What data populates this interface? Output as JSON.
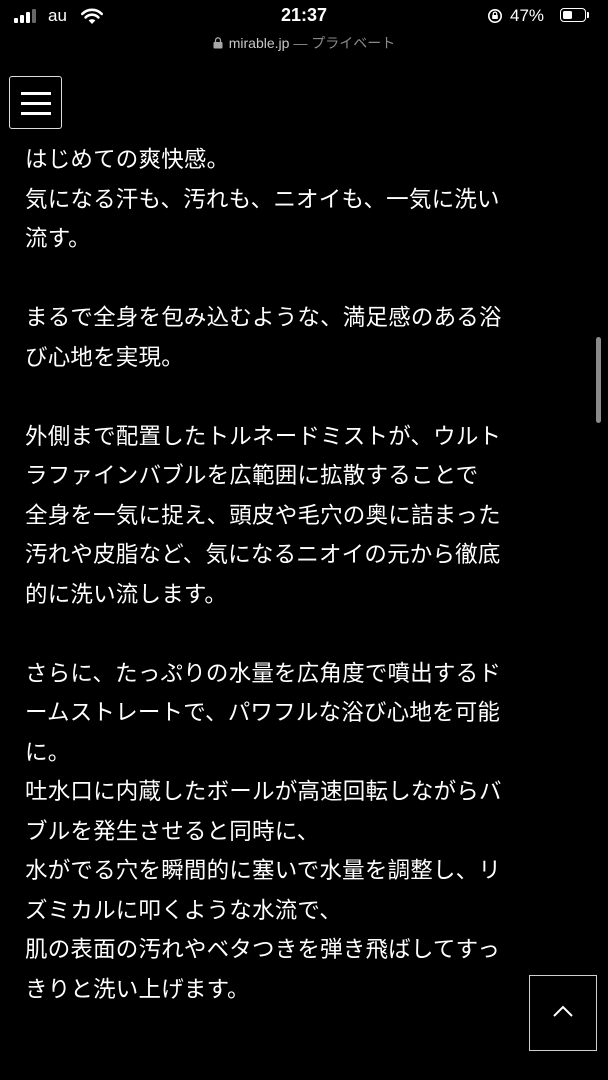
{
  "status_bar": {
    "carrier": "au",
    "time": "21:37",
    "battery_percent": "47%",
    "battery_level": 0.47,
    "icons": [
      "signal-icon",
      "wifi-icon",
      "rotation-lock-icon",
      "battery-icon"
    ]
  },
  "browser": {
    "domain": "mirable.jp",
    "private_label": "— プライベート",
    "lock_icon": "lock-icon"
  },
  "menu": {
    "icon": "hamburger-menu-icon"
  },
  "article": {
    "paragraphs": [
      "はじめての爽快感。\n気になる汗も、汚れも、ニオイも、一気に洗い\n流す。",
      "まるで全身を包み込むような、満足感のある浴\nび心地を実現。",
      "外側まで配置したトルネードミストが、ウルト\nラファインバブルを広範囲に拡散することで\n全身を一気に捉え、頭皮や毛穴の奥に詰まった\n汚れや皮脂など、気になるニオイの元から徹底\n的に洗い流します。",
      "さらに、たっぷりの水量を広角度で噴出するド\nームストレートで、パワフルな浴び心地を可能\nに。\n吐水口に内蔵したボールが高速回転しながらバ\nブルを発生させると同時に、\n水がでる穴を瞬間的に塞いで水量を調整し、リ\nズミカルに叩くような水流で、\n肌の表面の汚れやベタつきを弾き飛ばしてすっ\nきりと洗い上げます。"
    ]
  },
  "back_to_top": {
    "icon": "chevron-up-icon"
  },
  "colors": {
    "background": "#000000",
    "text": "#ffffff",
    "url_text": "#a8a8a8"
  }
}
